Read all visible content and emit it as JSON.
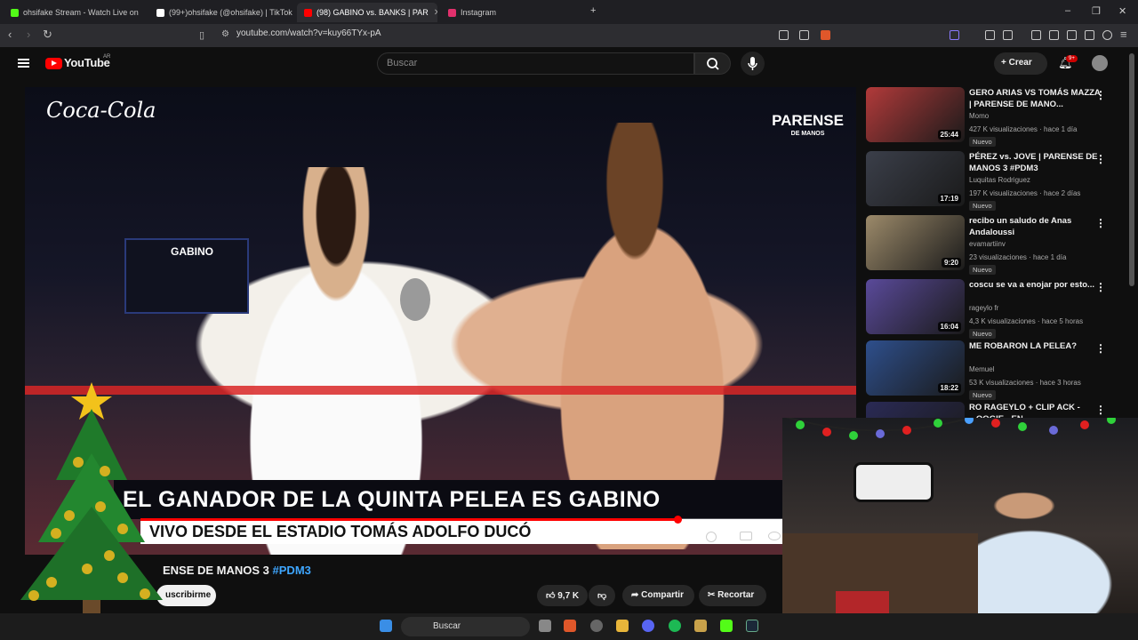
{
  "tabs": [
    {
      "title": "ohsifake Stream - Watch Live on",
      "color": "#53fc18",
      "active": false
    },
    {
      "title": "(99+)ohsifake (@ohsifake) | TikTok",
      "color": "#ffffff",
      "active": false
    },
    {
      "title": "(98) GABINO vs. BANKS | PAR",
      "color": "#ff0000",
      "active": true
    },
    {
      "title": "Instagram",
      "color": "#e1306c",
      "active": false
    }
  ],
  "new_tab": "+",
  "url": "youtube.com/watch?v=kuy66TYx-pA",
  "youtube": {
    "logo_text": "YouTube",
    "country": "AR",
    "search_placeholder": "Buscar",
    "create_label": "Crear",
    "notifications_badge": "9+"
  },
  "video": {
    "sponsor": "Coca-Cola",
    "channel_logo_main": "PARENSE",
    "channel_logo_sub": "DE MANOS",
    "scoreboard_name": "GABINO",
    "lower_third_1": "EL GANADOR DE LA QUINTA PELEA ES GABINO",
    "lower_third_2": "VIVO DESDE EL ESTADIO TOMÁS ADOLFO DUCÓ",
    "progress": 0.75
  },
  "below": {
    "title_text": "ENSE DE MANOS 3 ",
    "title_tag": "#PDM3",
    "subscribe": "uscribirme",
    "likes": "9,7 K",
    "share": "Compartir",
    "clip": "Recortar"
  },
  "recommendations": [
    {
      "title": "GERO ARIAS VS TOMÁS MAZZA | PARENSE DE MANO...",
      "channel": "Momo",
      "meta": "427 K visualizaciones · hace 1 día",
      "badge": "Nuevo",
      "duration": "25:44",
      "thumb": "#b23a3a"
    },
    {
      "title": "PÉREZ vs. JOVE | PARENSE DE MANOS 3 #PDM3",
      "channel": "Luquitas Rodriguez",
      "meta": "197 K visualizaciones · hace 2 días",
      "badge": "Nuevo",
      "duration": "17:19",
      "thumb": "#3b3f4a"
    },
    {
      "title": "recibo un saludo de Anas Andaloussi",
      "channel": "evamartiinv",
      "meta": "23 visualizaciones · hace 1 día",
      "badge": "Nuevo",
      "duration": "9:20",
      "thumb": "#9c8a6a"
    },
    {
      "title": "coscu se va a enojar por esto...",
      "channel": "rageylo fr",
      "meta": "4,3 K visualizaciones · hace 5 horas",
      "badge": "Nuevo",
      "duration": "16:04",
      "thumb": "#5a4a9a"
    },
    {
      "title": "ME ROBARON LA PELEA?",
      "channel": "Memuel",
      "meta": "53 K visualizaciones · hace 3 horas",
      "badge": "Nuevo",
      "duration": "18:22",
      "thumb": "#2e4f8c"
    },
    {
      "title": "RO RAGEYLO + CLIP ACK - ...OOGIE - EN",
      "channel": "",
      "meta": "",
      "badge": "",
      "duration": "",
      "thumb": "#2a2a55"
    }
  ],
  "taskbar": {
    "search": "Buscar"
  }
}
